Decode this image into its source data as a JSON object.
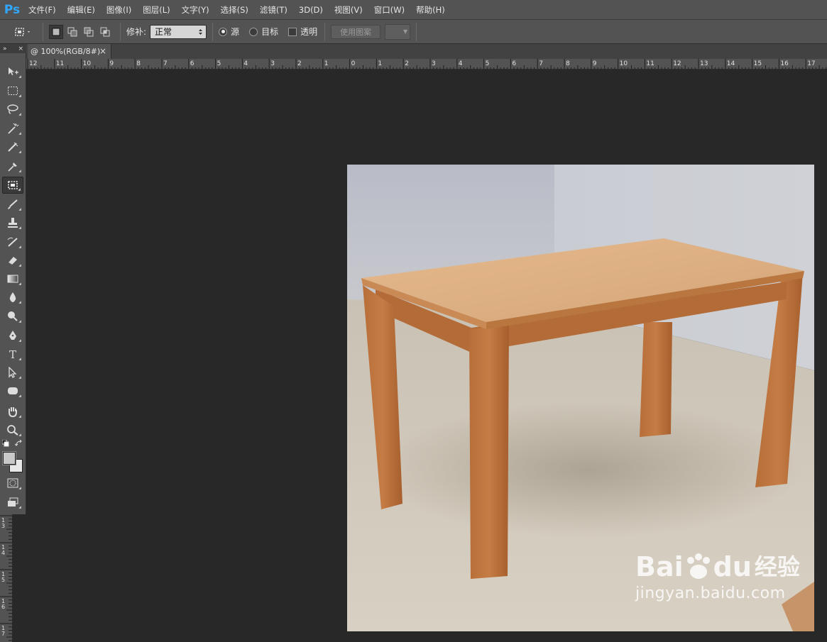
{
  "app": {
    "logo": "Ps"
  },
  "menu": [
    "文件(F)",
    "编辑(E)",
    "图像(I)",
    "图层(L)",
    "文字(Y)",
    "选择(S)",
    "滤镜(T)",
    "3D(D)",
    "视图(V)",
    "窗口(W)",
    "帮助(H)"
  ],
  "options": {
    "patch_label": "修补:",
    "patch_mode": "正常",
    "source_label": "源",
    "target_label": "目标",
    "transparent_label": "透明",
    "use_pattern_label": "使用图案",
    "source_selected": true
  },
  "document": {
    "tab_title": "@ 100%(RGB/8#)",
    "close_glyph": "×"
  },
  "toolbox": {
    "header_left": "»",
    "header_right": "×",
    "active_tool": "patch-tool"
  },
  "ruler": {
    "h_labels": [
      "12",
      "11",
      "10",
      "9",
      "8",
      "7",
      "6",
      "5",
      "4",
      "3",
      "2",
      "1",
      "0",
      "1",
      "2",
      "3",
      "4",
      "5",
      "6",
      "7",
      "8",
      "9",
      "10",
      "11",
      "12",
      "13",
      "14",
      "15",
      "16",
      "17"
    ],
    "v_labels": [
      "3",
      "4",
      "5",
      "6",
      "7"
    ]
  },
  "watermark": {
    "brand_prefix": "Bai",
    "brand_suffix": "du",
    "brand_cn": "经验",
    "url": "jingyan.baidu.com"
  },
  "colors": {
    "panel": "#535353",
    "workspace": "#282828",
    "ps_blue": "#31a8ff"
  }
}
